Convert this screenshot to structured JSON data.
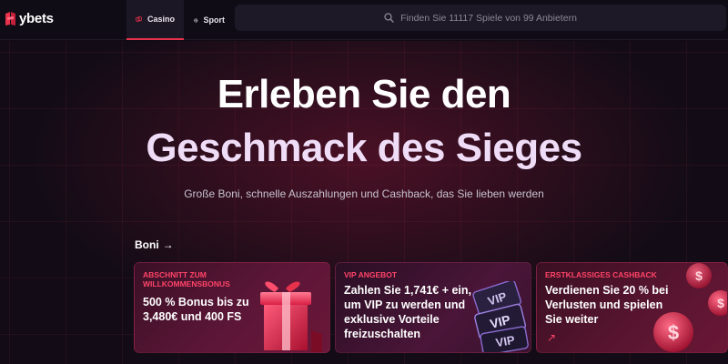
{
  "header": {
    "logo_text": "ybets",
    "tabs": [
      {
        "label": "Casino",
        "icon": "casino-icon",
        "active": true
      },
      {
        "label": "Sport",
        "icon": "sport-icon",
        "active": false
      }
    ],
    "search": {
      "placeholder": "Finden Sie 11117 Spiele von 99 Anbietern",
      "icon": "search-icon"
    }
  },
  "hero": {
    "title_line1": "Erleben Sie den",
    "title_line2": "Geschmack des Sieges",
    "subtitle": "Große Boni, schnelle Auszahlungen und Cashback, das Sie lieben werden"
  },
  "bonuses": {
    "heading": "Boni",
    "heading_arrow": "→",
    "cards": [
      {
        "label": "ABSCHNITT ZUM WILLKOMMENSBONUS",
        "text": "500 % Bonus bis zu 3,480€ und 400 FS",
        "image": "gift-box-icon"
      },
      {
        "label": "VIP ANGEBOT",
        "text": "Zahlen Sie 1,741€ + ein, um VIP zu werden und exklusive Vorteile freizuschalten",
        "image": "vip-cards-icon"
      },
      {
        "label": "ERSTKLASSIGES CASHBACK",
        "text": "Verdienen Sie 20 % bei Verlusten und spielen Sie weiter",
        "arrow": "↗",
        "image": "dollar-coins-icon"
      }
    ]
  },
  "colors": {
    "accent": "#e8324c",
    "label_red": "#ff4468",
    "background": "#100b14"
  }
}
